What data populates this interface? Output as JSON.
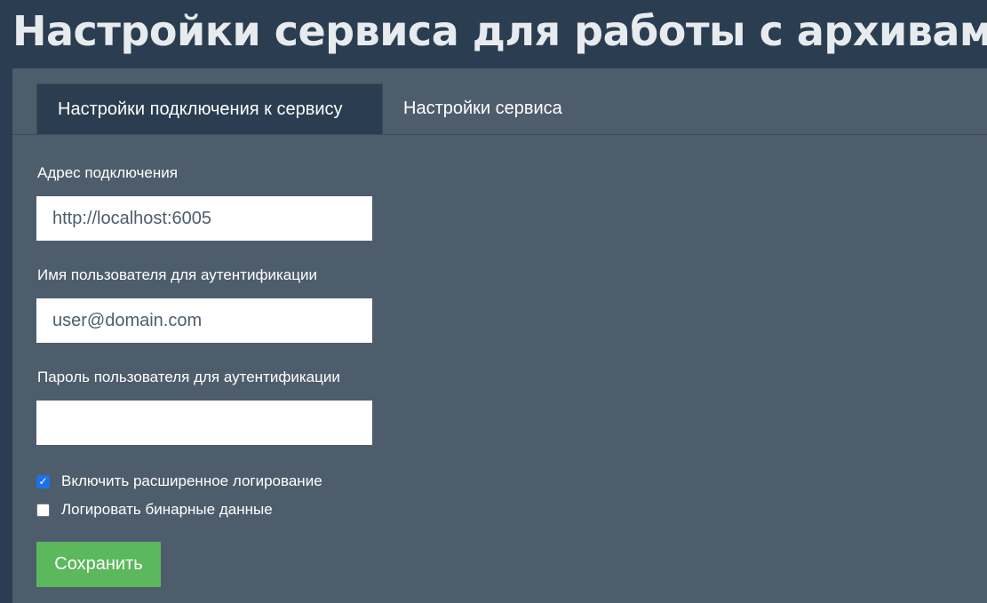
{
  "header": {
    "title": "Настройки сервиса для работы с архивами"
  },
  "tabs": [
    {
      "label": "Настройки подключения к сервису",
      "active": true
    },
    {
      "label": "Настройки сервиса",
      "active": false
    }
  ],
  "form": {
    "address": {
      "label": "Адрес подключения",
      "value": "http://localhost:6005"
    },
    "username": {
      "label": "Имя пользователя для аутентификации",
      "value": "user@domain.com"
    },
    "password": {
      "label": "Пароль пользователя для аутентификации",
      "value": ""
    },
    "checkboxes": [
      {
        "label": "Включить расширенное логирование",
        "checked": true
      },
      {
        "label": "Логировать бинарные данные",
        "checked": false
      }
    ],
    "save_label": "Сохранить"
  },
  "colors": {
    "page_background": "#2b3e51",
    "panel_background": "#4e5d6c",
    "active_tab_background": "#2b3e51",
    "save_button": "#5cb85c",
    "checkbox_checked": "#1a73e8"
  },
  "icons": {
    "checked": "checkmark-icon"
  }
}
